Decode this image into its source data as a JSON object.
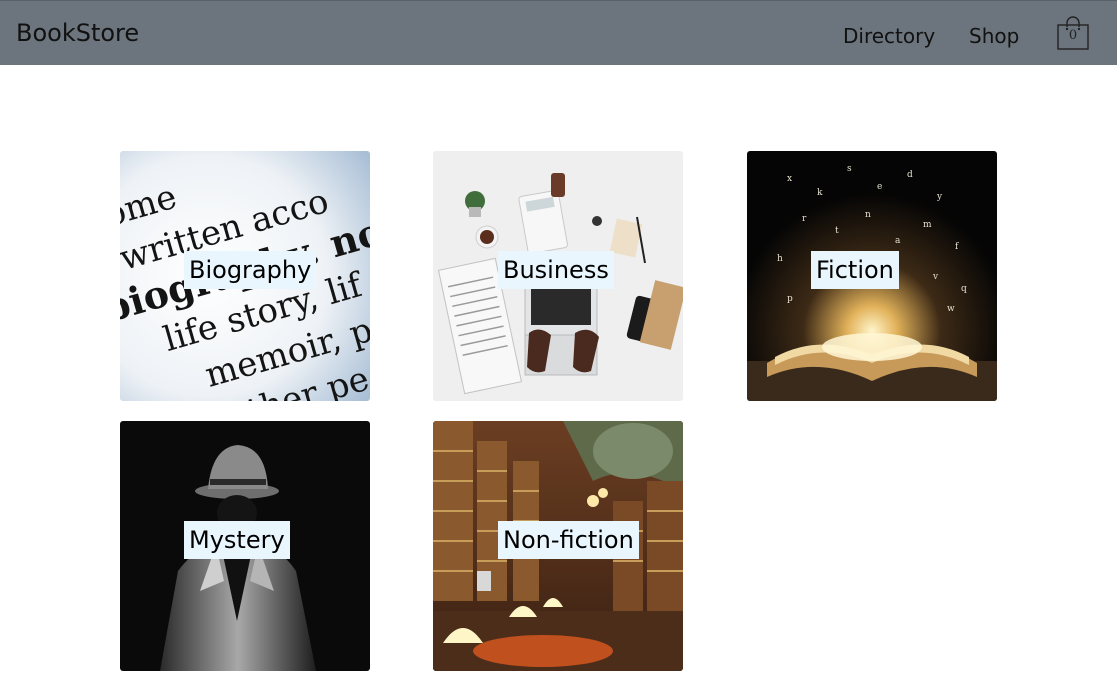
{
  "navbar": {
    "brand": "BookStore",
    "links": [
      "Directory",
      "Shop"
    ],
    "cart_count": "0"
  },
  "categories": [
    {
      "label": "Biography",
      "image_text": [
        "some",
        "written acco",
        "biography. no",
        "life story, lif",
        "memoir, pr",
        "other pe"
      ]
    },
    {
      "label": "Business"
    },
    {
      "label": "Fiction"
    },
    {
      "label": "Mystery"
    },
    {
      "label": "Non-fiction"
    }
  ]
}
